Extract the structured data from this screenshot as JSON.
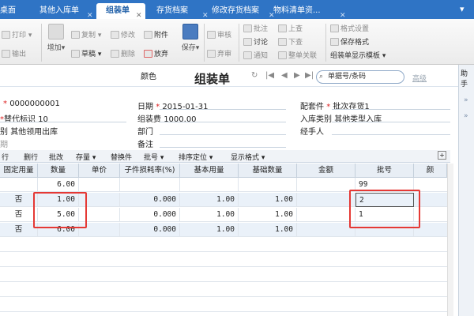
{
  "tabs": {
    "t0": "桌面",
    "t1": "其他入库单",
    "t2": "组装单",
    "t3": "存货档案",
    "t4": "修改存货档案",
    "t5": "物料清单资..."
  },
  "ribbon": {
    "print": "打印",
    "export": "输出",
    "add": "增加",
    "copy": "复制",
    "draft": "草稿",
    "modify": "修改",
    "delete": "删除",
    "attach": "附件",
    "abandon": "放弃",
    "save": "保存",
    "audit": "审核",
    "unaudit": "弃审",
    "annotate": "批注",
    "discuss": "讨论",
    "notify": "通知",
    "up": "上查",
    "down": "下查",
    "full": "整单关联",
    "fmt_set": "格式设置",
    "save_fmt": "保存格式",
    "template": "组装单显示模板"
  },
  "header": {
    "color_label": "颜色",
    "title": "组装单",
    "search_placeholder": "单据号/条码",
    "advanced": "高级",
    "help": "助手"
  },
  "form": {
    "doc_no": "0000000001",
    "date_label": "日期",
    "date": "2015-01-31",
    "kit_label": "配套件",
    "kit_value": "批次存货1",
    "replace_label": "替代标识",
    "replace_value": "10",
    "fee_label": "组装费",
    "fee_value": "1000.00",
    "in_type_label": "入库类别",
    "in_type_value": "其他类型入库",
    "out_type_label": "别",
    "out_type_value": "其他领用出库",
    "dept_label": "部门",
    "handler_label": "经手人",
    "period_label": "期",
    "remark_label": "备注"
  },
  "gridtools": {
    "g0": "行",
    "g1": "删行",
    "g2": "批改",
    "g3": "存量",
    "g4": "替换件",
    "g5": "批号",
    "g6": "排序定位",
    "g7": "显示格式"
  },
  "columns": {
    "c0": "固定用量",
    "c1": "数量",
    "c2": "单价",
    "c3": "子件损耗率(%)",
    "c4": "基本用量",
    "c5": "基础数量",
    "c6": "金额",
    "c7": "批号",
    "c8": "颜"
  },
  "rows": [
    {
      "fixed": "",
      "qty": "6.00",
      "rate": "",
      "base": "",
      "basic": "",
      "lot": "99"
    },
    {
      "fixed": "否",
      "qty": "1.00",
      "rate": "0.000",
      "base": "1.00",
      "basic": "1.00",
      "lot": "2"
    },
    {
      "fixed": "否",
      "qty": "5.00",
      "rate": "0.000",
      "base": "1.00",
      "basic": "1.00",
      "lot": "1"
    },
    {
      "fixed": "否",
      "qty": "6.00",
      "rate": "0.000",
      "base": "1.00",
      "basic": "1.00",
      "lot": ""
    }
  ]
}
